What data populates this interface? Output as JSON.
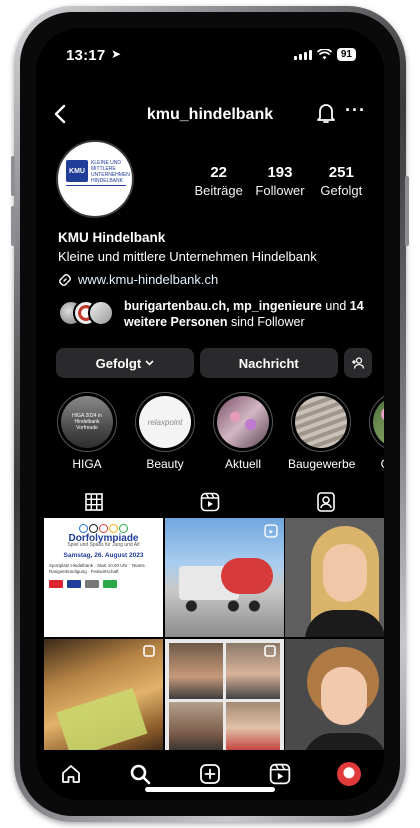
{
  "status_bar": {
    "time": "13:17",
    "battery": "91"
  },
  "header": {
    "username": "kmu_hindelbank"
  },
  "profile": {
    "avatar_badge": "KMU",
    "avatar_text": "KLEINE UND MITTLERE UNTERNEHMEN HINDELBANK",
    "stats": [
      {
        "value": "22",
        "label": "Beiträge"
      },
      {
        "value": "193",
        "label": "Follower"
      },
      {
        "value": "251",
        "label": "Gefolgt"
      }
    ],
    "name": "KMU Hindelbank",
    "description": "Kleine und mittlere Unternehmen Hindelbank",
    "website": "www.kmu-hindelbank.ch",
    "followed_by": {
      "names": "burigartenbau.ch, mp_ingenieure",
      "connector": " und ",
      "count": "14",
      "suffix_bold": " weitere Personen",
      "suffix_plain": " sind Follower"
    }
  },
  "buttons": {
    "follow": "Gefolgt",
    "message": "Nachricht"
  },
  "highlights": [
    {
      "label": "HIGA",
      "image_text": "HIGA 2024 in Hindelbank Vorfreude"
    },
    {
      "label": "Beauty",
      "image_text": "relaxpoint"
    },
    {
      "label": "Aktuell",
      "image_text": ""
    },
    {
      "label": "Baugewerbe",
      "image_text": ""
    },
    {
      "label": "Garten",
      "image_text": ""
    }
  ],
  "posts": [
    {
      "kind": "poster",
      "title": "Dorfolympiade",
      "subtitle": "Spiel und Spass für Jung und Alt",
      "date": "Samstag, 26. August 2023",
      "body": "Sportplatz Hindelbank · Start 10.00 Uhr · Teams · Rangverkündigung · Festwirtschaft"
    },
    {
      "kind": "truck"
    },
    {
      "kind": "portrait-blonde"
    },
    {
      "kind": "pastry"
    },
    {
      "kind": "collage"
    },
    {
      "kind": "portrait-curly"
    }
  ],
  "colors": {
    "background": "#000000",
    "button_bg": "#2a2a2c",
    "link": "#e0f1ff",
    "brand_blue": "#1f3d99"
  }
}
